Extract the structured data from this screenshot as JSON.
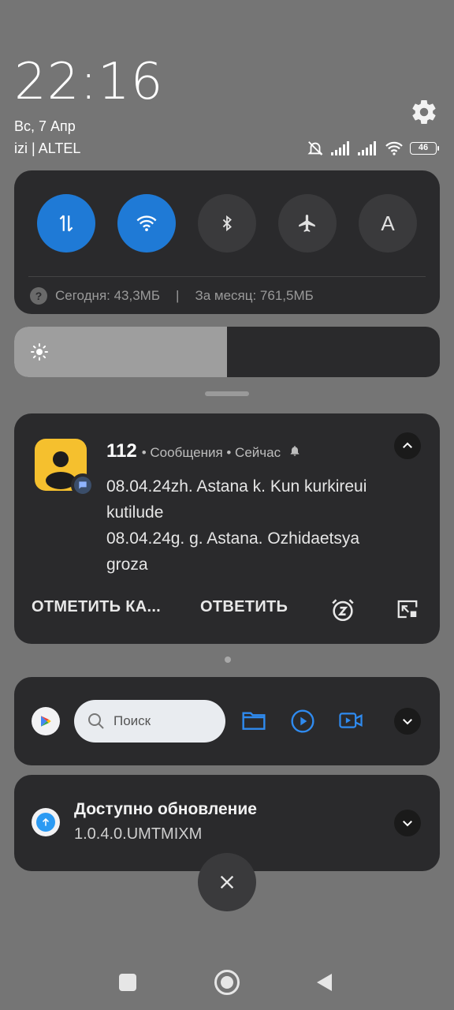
{
  "header": {
    "time": "22:16",
    "date": "Вс, 7 Апр",
    "carrier": "izi | ALTEL",
    "battery_level": "46",
    "icons": [
      "settings-gear-icon",
      "silent-mode-icon",
      "signal-icon",
      "signal-icon",
      "wifi-icon",
      "battery-icon"
    ]
  },
  "quick_settings": {
    "toggles": [
      {
        "name": "mobile-data",
        "icon": "mobile-data-icon",
        "state": "on"
      },
      {
        "name": "wifi",
        "icon": "wifi-icon",
        "state": "on"
      },
      {
        "name": "bluetooth",
        "icon": "bluetooth-icon",
        "state": "off"
      },
      {
        "name": "airplane-mode",
        "icon": "airplane-icon",
        "state": "off"
      },
      {
        "name": "auto-brightness",
        "label": "A",
        "state": "off"
      }
    ],
    "data_help_glyph": "?",
    "data_today": "Сегодня: 43,3МБ",
    "data_separator": "|",
    "data_month": "За месяц: 761,5МБ"
  },
  "brightness": {
    "level": 0.5
  },
  "notification": {
    "sender": "112",
    "meta": "• Сообщения • Сейчас",
    "lines": [
      "08.04.24zh. Astana k. Kun kurkireui",
      "kutilude",
      "08.04.24g. g. Astana. Ozhidaetsya",
      "groza"
    ],
    "actions": {
      "mark_read": "ОТМЕТИТЬ КА...",
      "reply": "ОТВЕТИТЬ"
    },
    "colors": {
      "app_icon": "#f5c02e"
    }
  },
  "search_widget": {
    "placeholder": "Поиск",
    "shortcuts": [
      "folder-icon",
      "play-circle-icon",
      "video-icon"
    ]
  },
  "update": {
    "title": "Доступно обновление",
    "version": "1.0.4.0.UMTMIXM"
  },
  "colors": {
    "accent": "#1f7ad6",
    "card": "#2a2a2c",
    "background": "#757575"
  }
}
